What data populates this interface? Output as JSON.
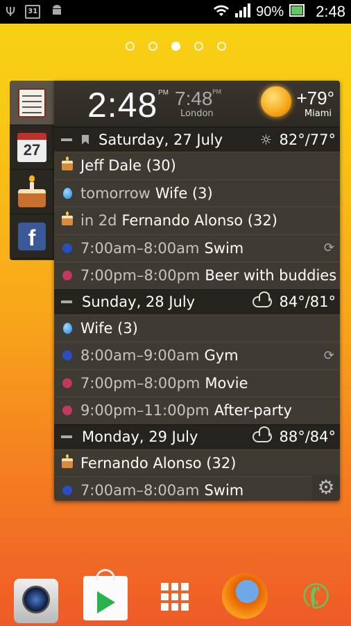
{
  "status_bar": {
    "usb_icon": "usb-icon",
    "calendar_day": "31",
    "android_icon": "android-icon",
    "battery_percent": "90%",
    "time": "2:48"
  },
  "pager": {
    "pages": 5,
    "active_index": 2
  },
  "widget": {
    "clock": {
      "time": "2:48",
      "ampm": "PM",
      "second_time": "7:48",
      "second_ampm": "PM",
      "second_city": "London"
    },
    "weather": {
      "temp": "+79°",
      "city": "Miami"
    },
    "days": [
      {
        "label": "Saturday, 27 July",
        "weather": "82°/77°",
        "weather_icon": "sun-icon",
        "events": [
          {
            "type": "birthday",
            "prefix": "",
            "title": "Jeff Dale (30)"
          },
          {
            "type": "anniversary",
            "prefix": "tomorrow",
            "title": "Wife (3)"
          },
          {
            "type": "birthday",
            "prefix": "in 2d",
            "title": "Fernando Alonso (32)"
          },
          {
            "type": "event",
            "color": "#2a4ec0",
            "prefix": "7:00am–8:00am",
            "title": "Swim",
            "repeat": true
          },
          {
            "type": "event",
            "color": "#c03a5a",
            "prefix": "7:00pm–8:00pm",
            "title": "Beer with buddies"
          }
        ]
      },
      {
        "label": "Sunday, 28 July",
        "weather": "84°/81°",
        "weather_icon": "cloud-icon",
        "events": [
          {
            "type": "anniversary",
            "prefix": "",
            "title": "Wife (3)"
          },
          {
            "type": "event",
            "color": "#2a4ec0",
            "prefix": "8:00am–9:00am",
            "title": "Gym",
            "repeat": true
          },
          {
            "type": "event",
            "color": "#c03a5a",
            "prefix": "7:00pm–8:00pm",
            "title": "Movie"
          },
          {
            "type": "event",
            "color": "#c03a5a",
            "prefix": "9:00pm–11:00pm",
            "title": "After-party"
          }
        ]
      },
      {
        "label": "Monday, 29 July",
        "weather": "88°/84°",
        "weather_icon": "cloud-icon",
        "events": [
          {
            "type": "birthday",
            "prefix": "",
            "title": "Fernando Alonso (32)"
          },
          {
            "type": "event",
            "color": "#2a4ec0",
            "prefix": "7:00am–8:00am",
            "title": "Swim"
          }
        ]
      }
    ]
  },
  "side_tabs": {
    "calendar_day": "27",
    "facebook_letter": "f"
  },
  "dock": [
    "camera-icon",
    "play-store-icon",
    "app-drawer-icon",
    "firefox-icon",
    "phone-icon"
  ]
}
